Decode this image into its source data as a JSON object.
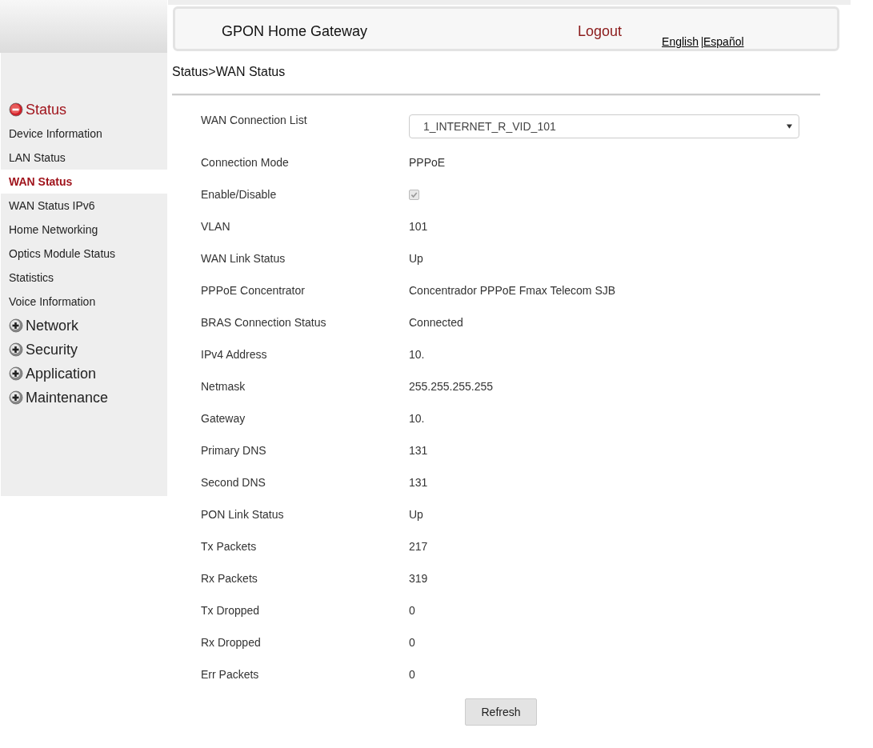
{
  "header": {
    "title": "GPON Home Gateway",
    "logout": "Logout",
    "languages": [
      "English",
      "Español"
    ]
  },
  "sidebar": {
    "groups": [
      {
        "label": "Status",
        "expanded": true,
        "items": [
          {
            "label": "Device Information",
            "selected": false
          },
          {
            "label": "LAN Status",
            "selected": false
          },
          {
            "label": "WAN Status",
            "selected": true
          },
          {
            "label": "WAN Status IPv6",
            "selected": false
          },
          {
            "label": "Home Networking",
            "selected": false
          },
          {
            "label": "Optics Module Status",
            "selected": false
          },
          {
            "label": "Statistics",
            "selected": false
          },
          {
            "label": "Voice Information",
            "selected": false
          }
        ]
      },
      {
        "label": "Network",
        "expanded": false
      },
      {
        "label": "Security",
        "expanded": false
      },
      {
        "label": "Application",
        "expanded": false
      },
      {
        "label": "Maintenance",
        "expanded": false
      }
    ]
  },
  "breadcrumb": "Status>WAN Status",
  "rows": [
    {
      "kind": "select",
      "label": "WAN Connection List",
      "value": "1_INTERNET_R_VID_101"
    },
    {
      "kind": "text",
      "label": "Connection Mode",
      "value": "PPPoE"
    },
    {
      "kind": "checkbox",
      "label": "Enable/Disable",
      "checked": true
    },
    {
      "kind": "text",
      "label": "VLAN",
      "value": "101"
    },
    {
      "kind": "text",
      "label": "WAN Link Status",
      "value": "Up"
    },
    {
      "kind": "text",
      "label": "PPPoE Concentrator",
      "value": "Concentrador PPPoE Fmax Telecom SJB"
    },
    {
      "kind": "text",
      "label": "BRAS Connection Status",
      "value": "Connected"
    },
    {
      "kind": "text",
      "label": "IPv4 Address",
      "value": "10."
    },
    {
      "kind": "text",
      "label": "Netmask",
      "value": "255.255.255.255"
    },
    {
      "kind": "text",
      "label": "Gateway",
      "value": "10."
    },
    {
      "kind": "text",
      "label": "Primary DNS",
      "value": "131"
    },
    {
      "kind": "text",
      "label": "Second DNS",
      "value": "131"
    },
    {
      "kind": "text",
      "label": "PON Link Status",
      "value": "Up"
    },
    {
      "kind": "text",
      "label": "Tx Packets",
      "value": "217"
    },
    {
      "kind": "text",
      "label": "Rx Packets",
      "value": "319"
    },
    {
      "kind": "text",
      "label": "Tx Dropped",
      "value": "0"
    },
    {
      "kind": "text",
      "label": "Rx Dropped",
      "value": "0"
    },
    {
      "kind": "text",
      "label": "Err Packets",
      "value": "0"
    }
  ],
  "refresh": "Refresh"
}
